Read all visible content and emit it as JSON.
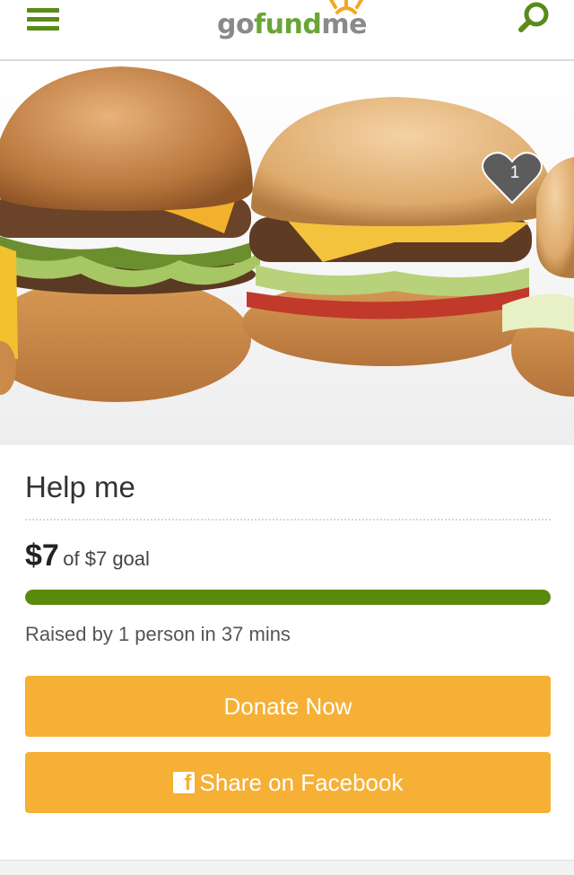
{
  "header": {
    "logo_go": "go",
    "logo_fund": "fund",
    "logo_me": "me",
    "brand_green": "#5a8a1a"
  },
  "hero": {
    "favorite_count": "1"
  },
  "campaign": {
    "title": "Help me",
    "amount_raised": "$7",
    "goal_text": "of $7 goal",
    "progress_fraction": 1.0,
    "raised_by": "Raised by 1 person in 37 mins"
  },
  "actions": {
    "donate_label": "Donate Now",
    "share_label": "Share on Facebook",
    "button_color": "#f5b035"
  }
}
